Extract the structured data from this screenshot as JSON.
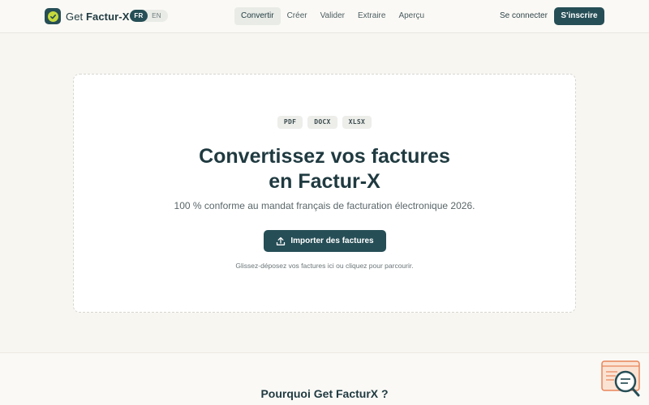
{
  "brand": {
    "name_prefix": "Get ",
    "name_main": "Factur-X"
  },
  "language": {
    "active": "FR",
    "inactive": "EN"
  },
  "nav": {
    "items": [
      {
        "label": "Convertir",
        "active": true
      },
      {
        "label": "Créer",
        "active": false
      },
      {
        "label": "Valider",
        "active": false
      },
      {
        "label": "Extraire",
        "active": false
      },
      {
        "label": "Aperçu",
        "active": false
      }
    ]
  },
  "auth": {
    "login_label": "Se connecter",
    "signup_label": "S'inscrire"
  },
  "upload": {
    "formats": [
      "PDF",
      "DOCX",
      "XLSX"
    ],
    "title": "Convertissez vos factures en Factur-X",
    "subtitle": "100 % conforme au mandat français de facturation électronique 2026.",
    "button_label": "Importer des factures",
    "hint": "Glissez-déposez vos factures ici ou cliquez pour parcourir."
  },
  "section": {
    "why_title": "Pourquoi Get FacturX ?"
  },
  "colors": {
    "primary": "#264e56",
    "accent": "#c6d93b",
    "background": "#f7f6f1"
  },
  "icons": {
    "logo": "check-circle-icon",
    "upload": "upload-icon",
    "widget": "chat-search-icon"
  }
}
